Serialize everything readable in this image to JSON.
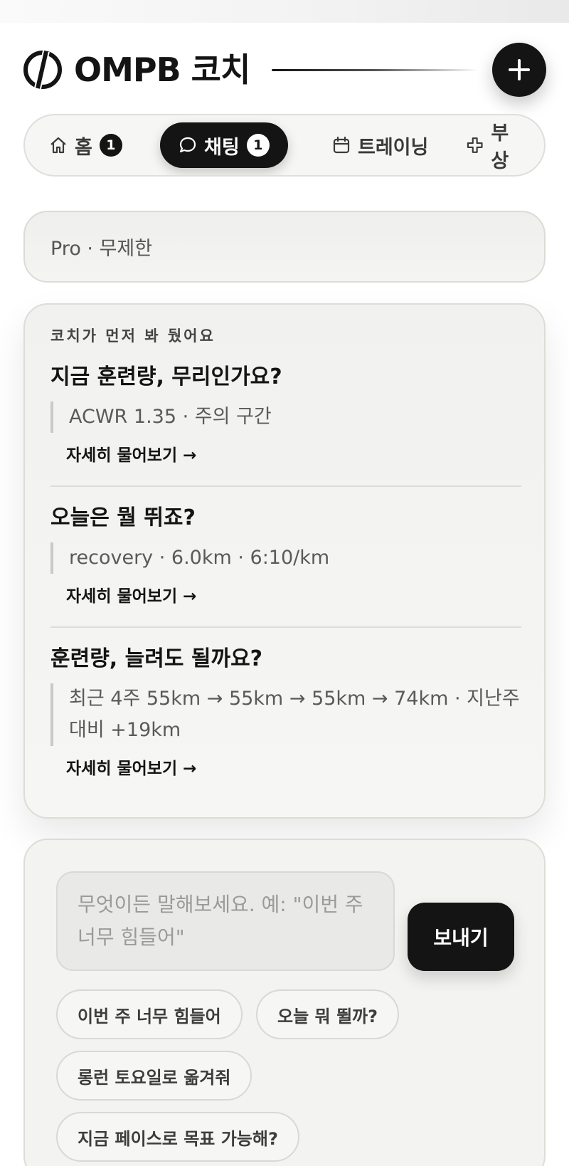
{
  "header": {
    "brand": "OMPB 코치",
    "logo_icon": "omp-logo-icon",
    "add_icon": "plus-icon"
  },
  "nav": {
    "items": [
      {
        "label": "홈",
        "icon": "home-icon",
        "badge": "1",
        "active": false
      },
      {
        "label": "채팅",
        "icon": "chat-bubble-icon",
        "badge": "1",
        "active": true
      },
      {
        "label": "트레이닝",
        "icon": "calendar-icon",
        "badge": "",
        "active": false
      },
      {
        "label": "부상",
        "icon": "medical-cross-icon",
        "badge": "",
        "active": false
      }
    ]
  },
  "plan": {
    "text": "Pro · 무제한"
  },
  "proactive": {
    "label": "코치가 먼저 봐 뒀어요",
    "insights": [
      {
        "title": "지금 훈련량, 무리인가요?",
        "detail": "ACWR 1.35 · 주의 구간",
        "link": "자세히 물어보기 →"
      },
      {
        "title": "오늘은 뭘 뛰죠?",
        "detail": "recovery · 6.0km · 6:10/km",
        "link": "자세히 물어보기 →"
      },
      {
        "title": "훈련량, 늘려도 될까요?",
        "detail": "최근 4주 55km → 55km → 55km → 74km · 지난주 대비 +19km",
        "link": "자세히 물어보기 →"
      }
    ]
  },
  "composer": {
    "placeholder": "무엇이든 말해보세요. 예: \"이번 주 너무 힘들어\"",
    "send_label": "보내기",
    "suggestions": [
      "이번 주 너무 힘들어",
      "오늘 뭐 뛸까?",
      "롱런 토요일로 옮겨줘",
      "지금 페이스로 목표 가능해?"
    ]
  },
  "colors": {
    "primary": "#141414",
    "surface": "#f3f3f1",
    "muted_text": "#5a5a5a"
  }
}
